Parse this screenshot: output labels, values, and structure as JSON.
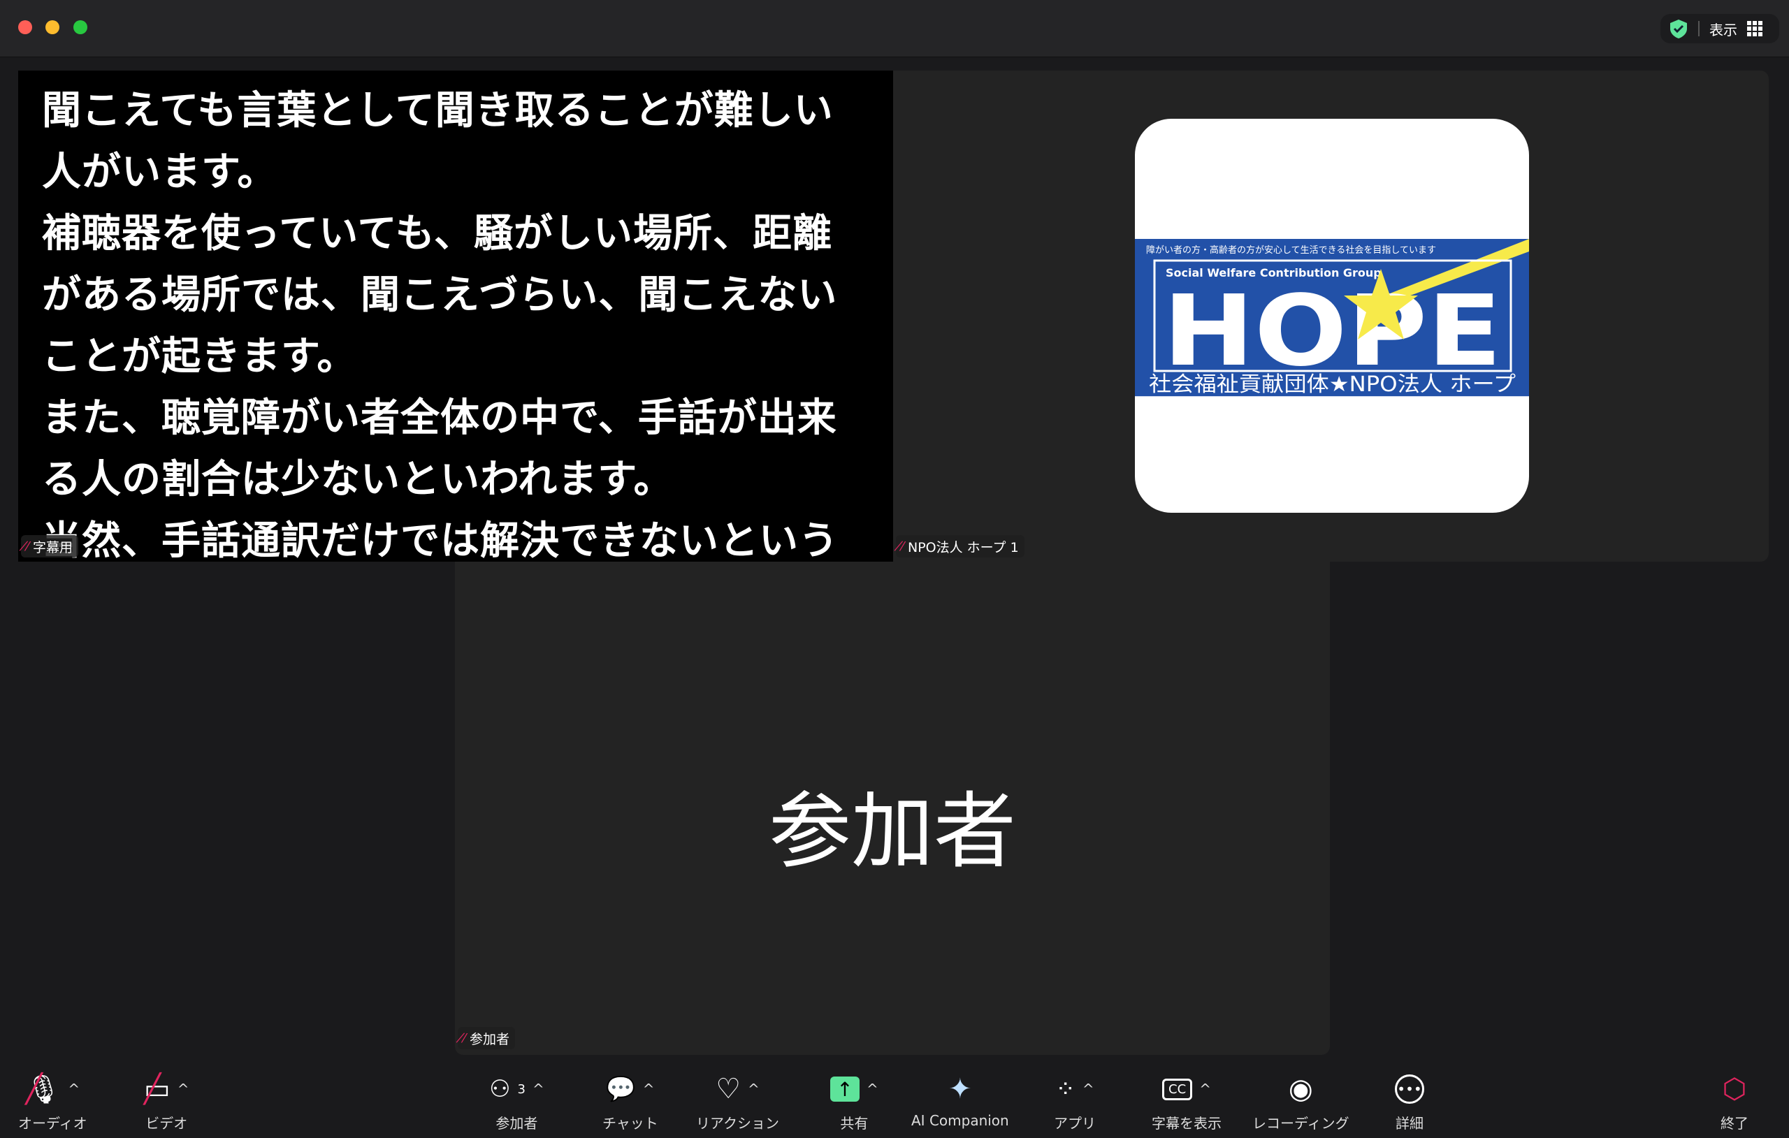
{
  "window": {
    "traffic_lights": [
      "#ff5f57",
      "#febc2e",
      "#28c840"
    ],
    "view_label": "表示",
    "security_color": "#5ee39a"
  },
  "caption_tile": {
    "lines": [
      "聞こえても言葉として聞き取ることが難しい",
      "人がいます。",
      "補聴器を使っていても、騒がしい場所、距離",
      "がある場所では、聞こえづらい、聞こえない",
      "ことが起きます。",
      "また、聴覚障がい者全体の中で、手話が出来",
      "る人の割合は少ないといわれます。",
      "当然、手話通訳だけでは解決できないという"
    ],
    "name": "字幕用"
  },
  "npo_tile": {
    "name": "NPO法人 ホープ 1",
    "logo": {
      "tagline": "障がい者の方・高齢者の方が安心して生活できる社会を目指しています",
      "subtitle": "Social Welfare Contribution Group",
      "word": "HOPE",
      "org": "社会福祉貢献団体★NPO法人 ホープ",
      "blue": "#2251a8",
      "yellow": "#f7ea4a"
    }
  },
  "participant_tile": {
    "big_name": "参加者",
    "name": "参加者"
  },
  "toolbar": {
    "audio": "オーディオ",
    "video": "ビデオ",
    "participants": "参加者",
    "participant_count": "3",
    "chat": "チャット",
    "reactions": "リアクション",
    "share": "共有",
    "ai": "AI Companion",
    "apps": "アプリ",
    "captions": "字幕を表示",
    "recording": "レコーディング",
    "more": "詳細",
    "end": "終了",
    "share_color": "#5ee39a",
    "end_color": "#e0245e"
  }
}
